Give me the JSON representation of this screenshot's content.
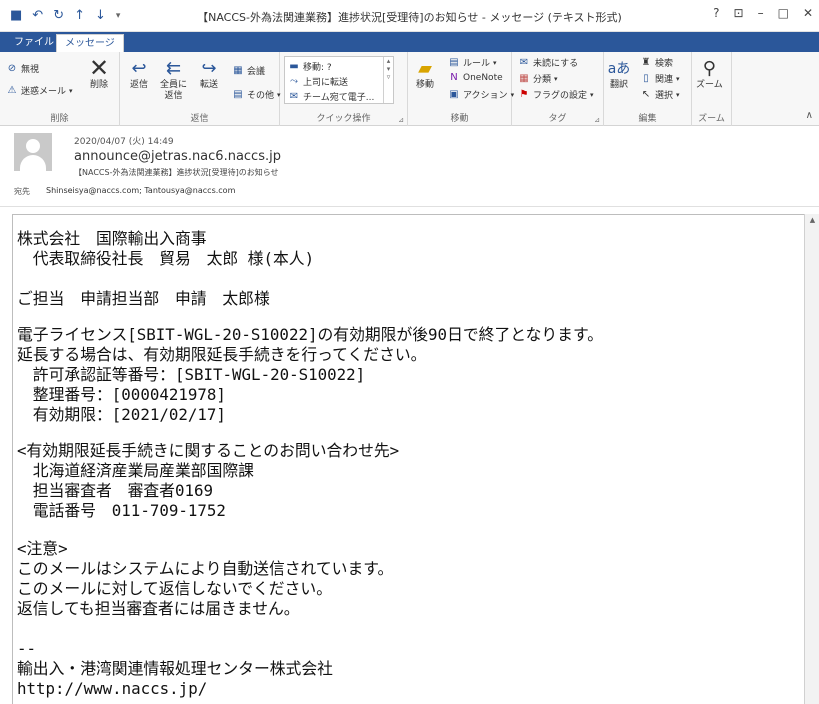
{
  "window": {
    "title": "【NACCS-外為法関連業務】進捗状況[受理待]のお知らせ - メッセージ (テキスト形式)",
    "qat_icons": [
      "save-icon",
      "undo-icon",
      "redo-icon",
      "up-icon",
      "down-icon",
      "customize-icon"
    ],
    "controls": {
      "help": "?",
      "ribbon_opts": "⊡",
      "minimize": "–",
      "maximize": "□",
      "close": "✕"
    }
  },
  "tabs": [
    {
      "label": "ファイル"
    },
    {
      "label": "メッセージ"
    }
  ],
  "ribbon": {
    "delete": {
      "label": "削除",
      "ignore": "無視",
      "junk": "迷惑メール",
      "delete": "削除"
    },
    "respond": {
      "label": "返信",
      "reply": "返信",
      "reply_all": "全員に\n返信",
      "forward": "転送",
      "meeting": "会議",
      "more": "その他"
    },
    "quick_steps": {
      "label": "クイック操作",
      "items": [
        "移動: ?",
        "上司に転送",
        "チーム宛て電子..."
      ]
    },
    "move": {
      "label": "移動",
      "move": "移動",
      "rules": "ルール",
      "onenote": "OneNote",
      "actions": "アクション"
    },
    "tags": {
      "label": "タグ",
      "unread": "未読にする",
      "categorize": "分類",
      "followup": "フラグの設定"
    },
    "editing": {
      "label": "編集",
      "translate": "翻訳",
      "find": "検索",
      "related": "関連",
      "select": "選択"
    },
    "zoom": {
      "label": "ズーム",
      "zoom": "ズーム"
    }
  },
  "header": {
    "date": "2020/04/07 (火) 14:49",
    "from": "announce@jetras.nac6.naccs.jp",
    "subject": "【NACCS-外為法関連業務】進捗状況[受理待]のお知らせ",
    "to_label": "宛先",
    "to": "Shinseisya@naccs.com; Tantousya@naccs.com"
  },
  "body_lines": [
    "株式会社　国際輸出入商事",
    "　代表取締役社長　貿易　太郎 様(本人)",
    "",
    "ご担当　申請担当部　申請　太郎様",
    "",
    "電子ライセンス[SBIT-WGL-20-S10022]の有効期限が後90日で終了となります。",
    "延長する場合は、有効期限延長手続きを行ってください。",
    "　許可承認証等番号：[SBIT-WGL-20-S10022]",
    "　整理番号：[0000421978]",
    "　有効期限：[2021/02/17]",
    "",
    "<有効期限延長手続きに関することのお問い合わせ先>",
    "　北海道経済産業局産業部国際課",
    "　担当審査者　審査者0169",
    "　電話番号　011-709-1752",
    "",
    "<注意>",
    "このメールはシステムにより自動送信されています。",
    "このメールに対して返信しないでください。",
    "返信しても担当審査者には届きません。",
    "",
    "--",
    "輸出入・港湾関連情報処理センター株式会社",
    "http://www.naccs.jp/"
  ]
}
